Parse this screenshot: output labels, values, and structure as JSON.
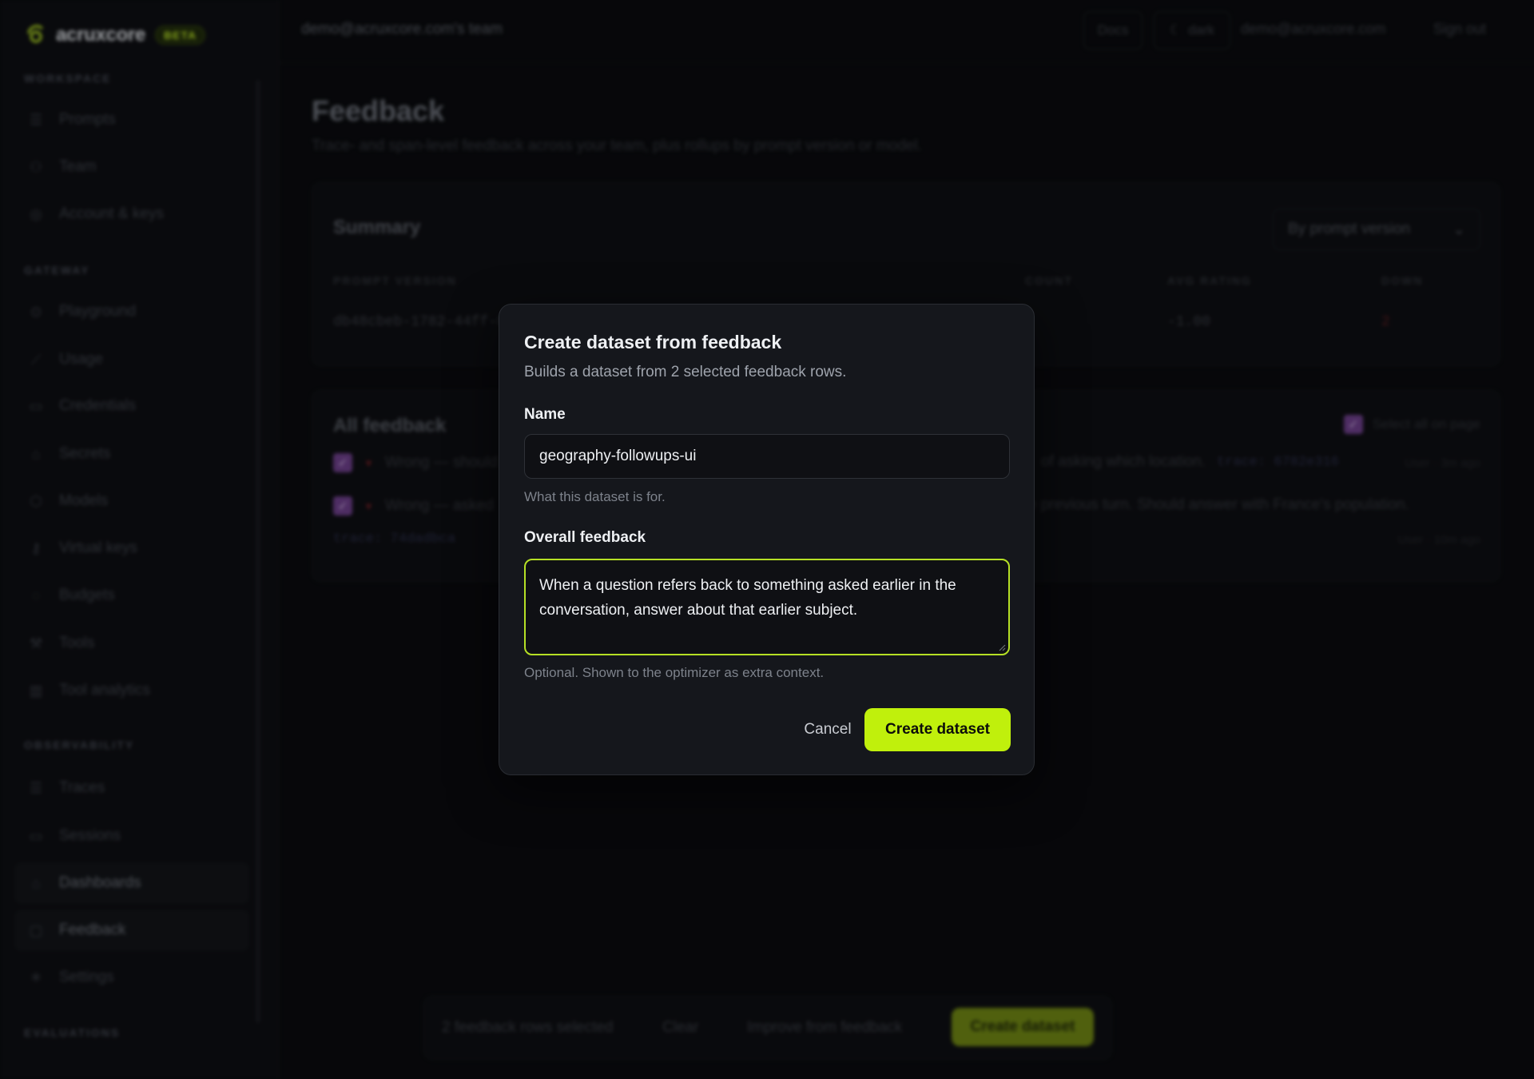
{
  "brand": {
    "name": "acruxcore",
    "badge": "BETA"
  },
  "sidebar": {
    "sections": [
      {
        "label": "WORKSPACE",
        "items": [
          {
            "label": "Prompts",
            "icon": "prompts-icon"
          },
          {
            "label": "Team",
            "icon": "team-icon"
          },
          {
            "label": "Account & keys",
            "icon": "account-icon"
          }
        ]
      },
      {
        "label": "GATEWAY",
        "items": [
          {
            "label": "Playground",
            "icon": "playground-icon"
          },
          {
            "label": "Usage",
            "icon": "usage-icon"
          },
          {
            "label": "Credentials",
            "icon": "credentials-icon"
          },
          {
            "label": "Secrets",
            "icon": "lock-icon"
          },
          {
            "label": "Models",
            "icon": "models-icon"
          },
          {
            "label": "Virtual keys",
            "icon": "key-icon"
          },
          {
            "label": "Budgets",
            "icon": "budget-icon"
          },
          {
            "label": "Tools",
            "icon": "wrench-icon"
          },
          {
            "label": "Tool analytics",
            "icon": "bar-chart-icon"
          }
        ]
      },
      {
        "label": "OBSERVABILITY",
        "items": [
          {
            "label": "Traces",
            "icon": "traces-icon"
          },
          {
            "label": "Sessions",
            "icon": "sessions-icon"
          },
          {
            "label": "Dashboards",
            "icon": "dashboard-icon"
          },
          {
            "label": "Feedback",
            "icon": "chat-icon",
            "active": true
          },
          {
            "label": "Settings",
            "icon": "settings-icon"
          }
        ]
      },
      {
        "label": "EVALUATIONS",
        "items": []
      }
    ]
  },
  "header": {
    "team": "demo@acruxcore.com's team",
    "docs": "Docs",
    "theme": "dark",
    "email": "demo@acruxcore.com",
    "signout": "Sign out"
  },
  "page": {
    "title": "Feedback",
    "subtitle": "Trace- and span-level feedback across your team, plus rollups by prompt version or model."
  },
  "summary": {
    "title": "Summary",
    "group_by": "By prompt version",
    "columns": [
      "PROMPT VERSION",
      "COUNT",
      "AVG RATING",
      "DOWN"
    ],
    "row": {
      "prompt_version": "db48cbeb-1782-44ff-8",
      "avg_rating": "-1.00",
      "down": "2"
    }
  },
  "all_feedback": {
    "title": "All feedback",
    "select_all": "Select all on page",
    "rows": [
      {
        "text_left": "Wrong — should",
        "text_right": "of asking which location.",
        "trace": "trace: 6782e316",
        "meta": "User · 3m ago"
      },
      {
        "text_left": "Wrong — asked",
        "text_right": "e previous turn. Should answer with France's population.",
        "trace": "trace: 74dadbca",
        "meta": "User · 10m ago"
      }
    ]
  },
  "bottom_bar": {
    "selected": "2 feedback rows selected",
    "clear": "Clear",
    "improve": "Improve from feedback",
    "create": "Create dataset"
  },
  "modal": {
    "title": "Create dataset from feedback",
    "description": "Builds a dataset from 2 selected feedback rows.",
    "name_label": "Name",
    "name_value": "geography-followups-ui",
    "name_help": "What this dataset is for.",
    "feedback_label": "Overall feedback",
    "feedback_value": "When a question refers back to something asked earlier in the conversation, answer about that earlier subject.",
    "feedback_help": "Optional. Shown to the optimizer as extra context.",
    "cancel": "Cancel",
    "create": "Create dataset"
  },
  "colors": {
    "accent": "#c0f00c",
    "background": "#0a0b0e",
    "modal": "#15171c"
  }
}
